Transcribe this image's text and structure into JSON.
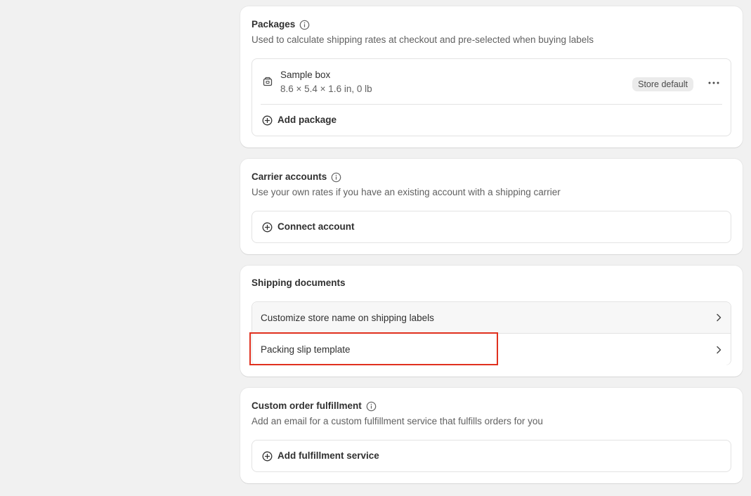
{
  "packages": {
    "title": "Packages",
    "description": "Used to calculate shipping rates at checkout and pre-selected when buying labels",
    "items": [
      {
        "name": "Sample box",
        "dimensions": "8.6 × 5.4 × 1.6 in, 0 lb",
        "badge": "Store default",
        "icon": "package-icon"
      }
    ],
    "add_label": "Add package"
  },
  "carrier_accounts": {
    "title": "Carrier accounts",
    "description": "Use your own rates if you have an existing account with a shipping carrier",
    "connect_label": "Connect account"
  },
  "shipping_documents": {
    "title": "Shipping documents",
    "rows": [
      {
        "label": "Customize store name on shipping labels"
      },
      {
        "label": "Packing slip template"
      }
    ]
  },
  "custom_fulfillment": {
    "title": "Custom order fulfillment",
    "description": "Add an email for a custom fulfillment service that fulfills orders for you",
    "add_label": "Add fulfillment service"
  },
  "colors": {
    "page_bg": "#f1f1f1",
    "card_bg": "#ffffff",
    "highlight": "#e0301e"
  }
}
